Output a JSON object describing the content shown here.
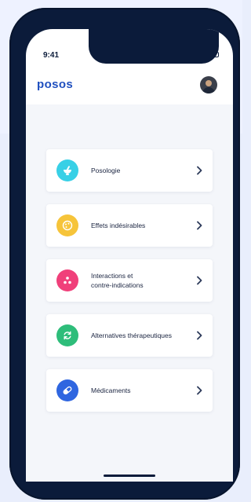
{
  "status_bar": {
    "time": "9:41"
  },
  "header": {
    "logo": "posos"
  },
  "menu": [
    {
      "label": "Posologie",
      "color": "#38d0e6",
      "icon": "mortar-icon"
    },
    {
      "label": "Effets indésirables",
      "color": "#f6c43a",
      "icon": "palette-icon"
    },
    {
      "label": "Interactions et\ncontre-indications",
      "color": "#f0407a",
      "icon": "molecule-icon"
    },
    {
      "label": "Alternatives thérapeutiques",
      "color": "#2ebd7a",
      "icon": "refresh-icon"
    },
    {
      "label": "Médicaments",
      "color": "#2f66e0",
      "icon": "pill-icon"
    }
  ]
}
